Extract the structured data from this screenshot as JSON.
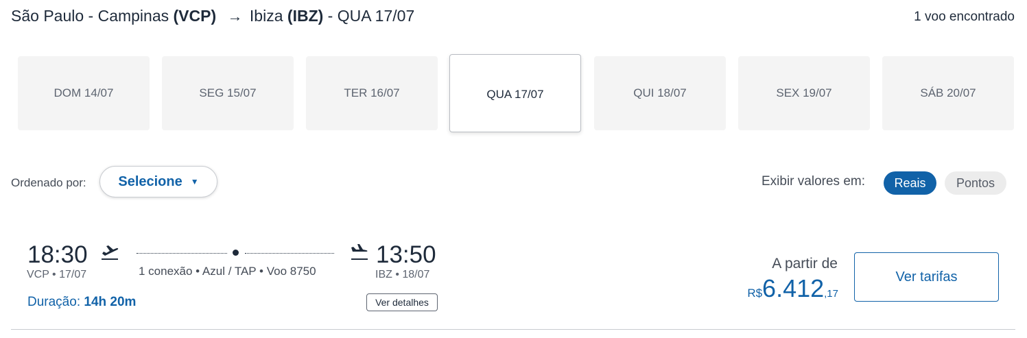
{
  "header": {
    "origin_city": "São Paulo - Campinas",
    "origin_code": "(VCP)",
    "arrow": "→",
    "dest_city": "Ibiza",
    "dest_code": "(IBZ)",
    "date": "- QUA 17/07",
    "results": "1 voo encontrado"
  },
  "date_tabs": [
    {
      "label": "DOM 14/07"
    },
    {
      "label": "SEG 15/07"
    },
    {
      "label": "TER 16/07"
    },
    {
      "label": "QUA 17/07",
      "selected": true
    },
    {
      "label": "QUI 18/07"
    },
    {
      "label": "SEX 19/07"
    },
    {
      "label": "SÁB 20/07"
    }
  ],
  "sort": {
    "label": "Ordenado por:",
    "value": "Selecione",
    "caret": "▼"
  },
  "currency_toggle": {
    "label": "Exibir valores em:",
    "options": [
      "Reais",
      "Pontos"
    ],
    "selected": "Reais"
  },
  "flight": {
    "departure_time": "18:30",
    "departure_info": "VCP • 17/07",
    "arrival_time": "13:50",
    "arrival_info": "IBZ • 18/07",
    "route_info": "1 conexão • Azul / TAP • Voo 8750",
    "duration_label": "Duração:",
    "duration_value": "14h 20m",
    "details_button": "Ver detalhes",
    "price_label": "A partir de",
    "price_currency": "R$",
    "price_integer": "6.412",
    "price_cents": ",17",
    "fares_button": "Ver tarifas"
  },
  "colors": {
    "accent": "#1162a8",
    "text": "#1e2a3a",
    "tab_bg": "#f4f4f4"
  }
}
